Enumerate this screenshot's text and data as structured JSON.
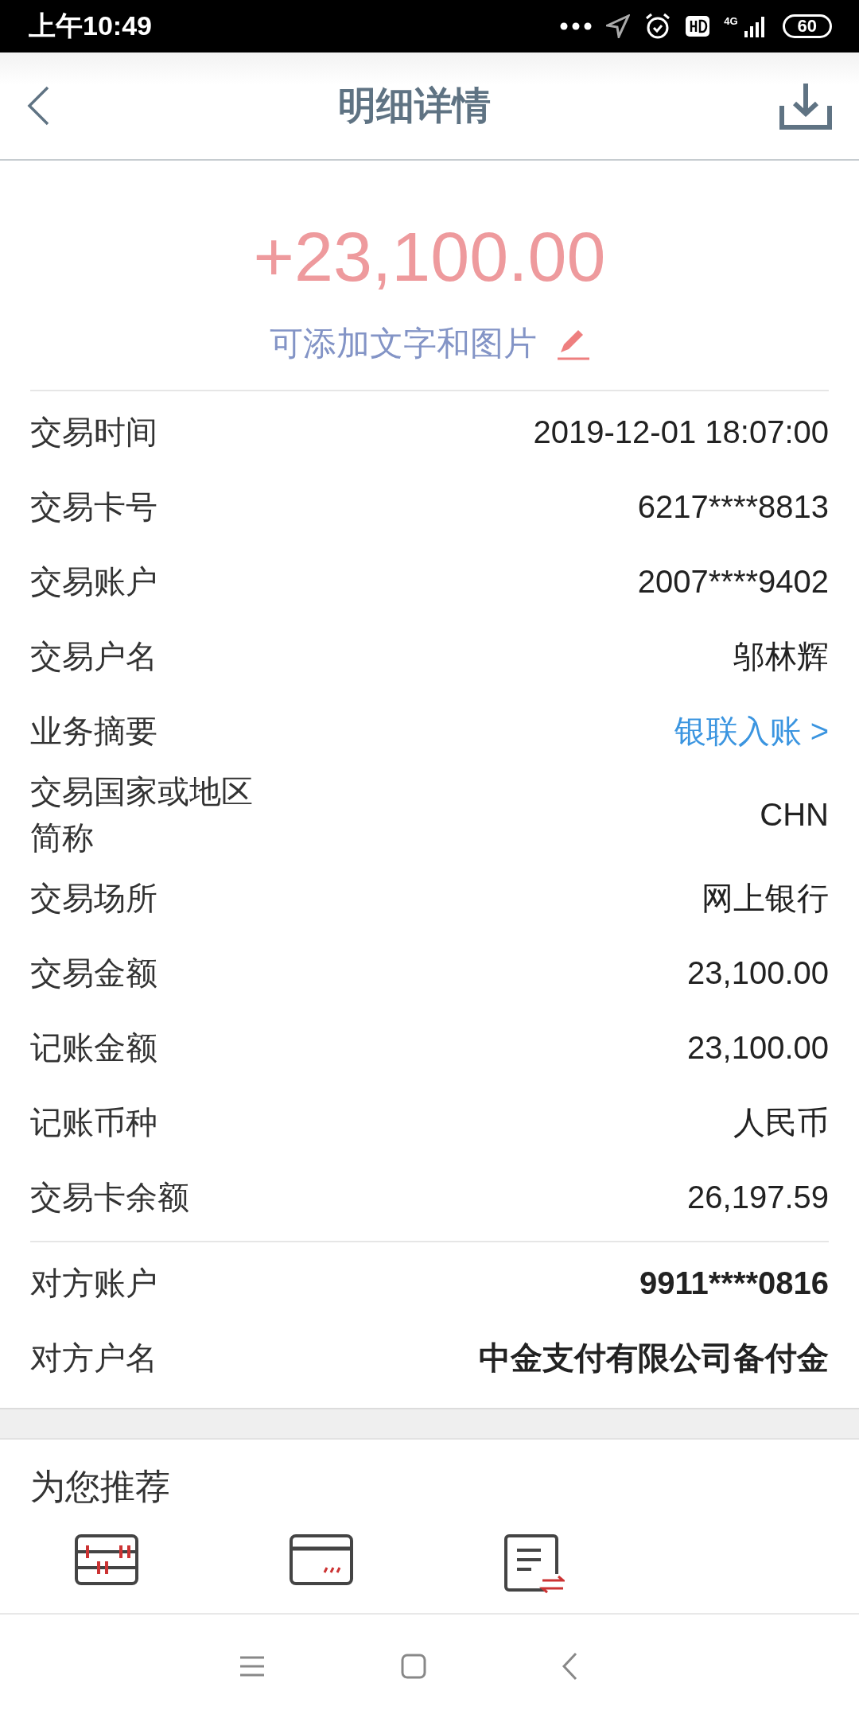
{
  "status_bar": {
    "time": "上午10:49",
    "network": "4G",
    "battery": "60"
  },
  "header": {
    "title": "明细详情"
  },
  "amount": "+23,100.00",
  "note": "可添加文字和图片",
  "details": [
    {
      "label": "交易时间",
      "value": "2019-12-01 18:07:00",
      "kind": "plain"
    },
    {
      "label": "交易卡号",
      "value": "6217****8813",
      "kind": "plain"
    },
    {
      "label": "交易账户",
      "value": "2007****9402",
      "kind": "plain"
    },
    {
      "label": "交易户名",
      "value": "邬林辉",
      "kind": "plain"
    },
    {
      "label": "业务摘要",
      "value": "银联入账 >",
      "kind": "link"
    },
    {
      "label": "交易国家或地区简称",
      "value": "CHN",
      "kind": "plain"
    },
    {
      "label": "交易场所",
      "value": "网上银行",
      "kind": "plain"
    },
    {
      "label": "交易金额",
      "value": "23,100.00",
      "kind": "plain"
    },
    {
      "label": "记账金额",
      "value": "23,100.00",
      "kind": "plain"
    },
    {
      "label": "记账币种",
      "value": "人民币",
      "kind": "plain"
    },
    {
      "label": "交易卡余额",
      "value": "26,197.59",
      "kind": "plain"
    }
  ],
  "counterparty": [
    {
      "label": "对方账户",
      "value": "9911****0816",
      "kind": "bold"
    },
    {
      "label": "对方户名",
      "value": "中金支付有限公司备付金",
      "kind": "bold"
    }
  ],
  "recommend": {
    "title": "为您推荐",
    "items": [
      {
        "kind": "abacus"
      },
      {
        "kind": "card"
      },
      {
        "kind": "statement"
      }
    ]
  }
}
